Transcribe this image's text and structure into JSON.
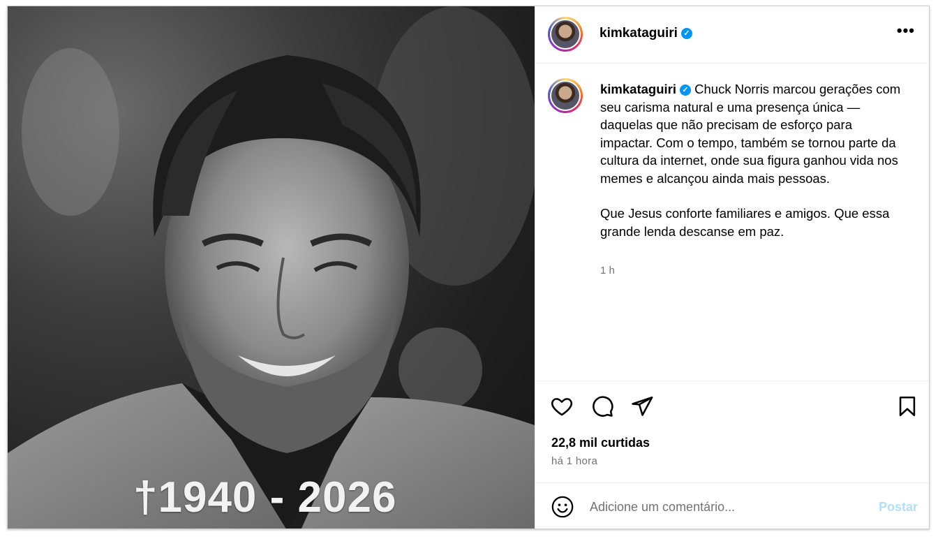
{
  "media": {
    "overlay_text": "†1940 - 2026"
  },
  "post": {
    "username": "kimkataguiri",
    "verified": true,
    "caption_para1": "Chuck Norris marcou gerações com seu carisma natural e uma presença única — daquelas que não precisam de esforço para impactar. Com o tempo, também se tornou parte da cultura da internet, onde sua figura ganhou vida nos memes e alcançou ainda mais pessoas.",
    "caption_para2": "Que Jesus conforte familiares e amigos. Que essa grande lenda descanse em paz.",
    "caption_time": "1 h",
    "likes": "22,8 mil curtidas",
    "posted_when": "há 1 hora"
  },
  "actions": {
    "like_icon": "heart-icon",
    "comment_icon": "comment-icon",
    "share_icon": "paper-plane-icon",
    "save_icon": "bookmark-icon",
    "more_icon": "more-horizontal-icon"
  },
  "comment": {
    "placeholder": "Adicione um comentário...",
    "post_label": "Postar",
    "emoji_icon": "smiley-icon"
  },
  "colors": {
    "verified": "#0095f6",
    "post_button": "#b2dffc",
    "secondary_text": "#737373"
  }
}
